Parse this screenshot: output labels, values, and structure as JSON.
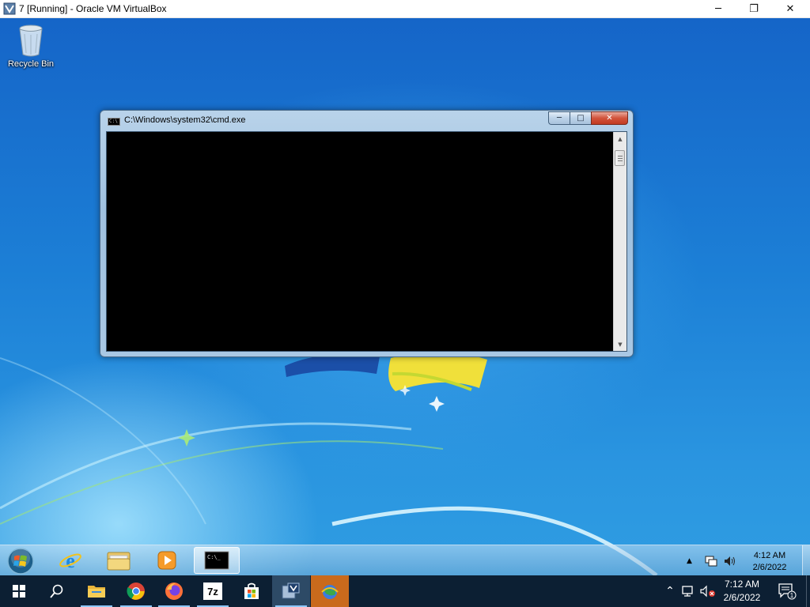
{
  "host_window": {
    "title": "7 [Running] - Oracle VM VirtualBox",
    "controls": {
      "minimize": "─",
      "restore": "❐",
      "close": "✕"
    }
  },
  "desktop": {
    "icons": [
      {
        "label": "Recycle Bin",
        "icon": "recycle-bin-icon"
      }
    ]
  },
  "cmd_window": {
    "title": "C:\\Windows\\system32\\cmd.exe",
    "icon_text": "C:\\",
    "buttons": {
      "minimize": "─",
      "maximize": "□",
      "close": "✕"
    },
    "content": ""
  },
  "guest_taskbar": {
    "pinned": [
      "internet-explorer-icon",
      "windows-explorer-icon",
      "media-player-icon"
    ],
    "running": [
      "cmd-icon"
    ],
    "tray": [
      "show-hidden-icons-icon",
      "network-icon",
      "volume-icon"
    ],
    "tray_arrow": "▲",
    "cmd_label": "C:\\_",
    "clock": {
      "time": "4:12 AM",
      "date": "2/6/2022"
    }
  },
  "host_taskbar": {
    "apps": [
      "start-icon",
      "search-icon",
      "file-explorer-icon",
      "chrome-icon",
      "firefox-icon",
      "7zip-icon",
      "microsoft-store-icon",
      "virtualbox-icon",
      "network-globe-icon"
    ],
    "sevenzip_label": "7z",
    "tray_arrow": "⌃",
    "clock": {
      "time": "7:12 AM",
      "date": "2/6/2022"
    },
    "notification_count": "1"
  },
  "colors": {
    "console_background": "#000000",
    "host_taskbar": "#0c1f33",
    "desktop_blue": "#1c7fd6"
  }
}
